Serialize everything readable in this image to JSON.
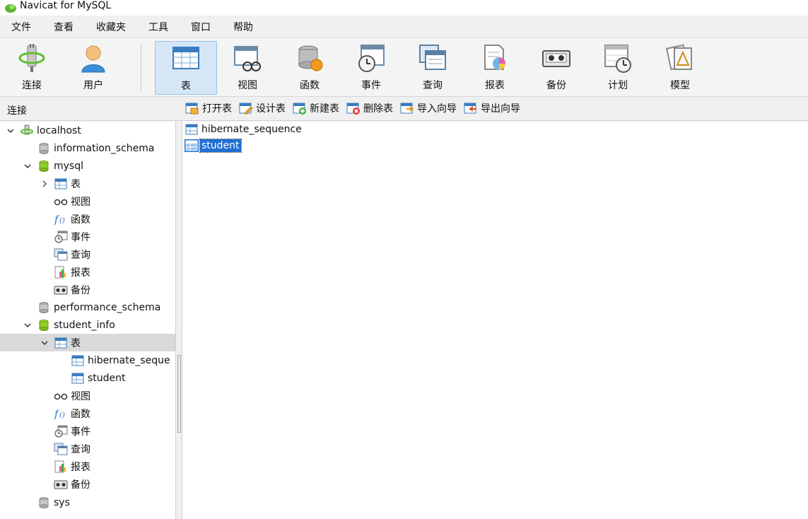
{
  "window": {
    "title": "Navicat for MySQL"
  },
  "menu": [
    "文件",
    "查看",
    "收藏夹",
    "工具",
    "窗口",
    "帮助"
  ],
  "toolbar": {
    "buttons": [
      {
        "label": "连接",
        "icon": "connect-icon"
      },
      {
        "label": "用户",
        "icon": "user-icon"
      },
      {
        "label": "表",
        "icon": "table-icon",
        "active": true
      },
      {
        "label": "视图",
        "icon": "view-icon"
      },
      {
        "label": "函数",
        "icon": "function-icon"
      },
      {
        "label": "事件",
        "icon": "event-icon"
      },
      {
        "label": "查询",
        "icon": "query-icon"
      },
      {
        "label": "报表",
        "icon": "report-icon"
      },
      {
        "label": "备份",
        "icon": "backup-icon"
      },
      {
        "label": "计划",
        "icon": "schedule-icon"
      },
      {
        "label": "模型",
        "icon": "model-icon"
      }
    ]
  },
  "subbar": {
    "connection_label": "连接",
    "actions": [
      "打开表",
      "设计表",
      "新建表",
      "删除表",
      "导入向导",
      "导出向导"
    ]
  },
  "tree": [
    {
      "label": "localhost",
      "icon": "connection-icon",
      "expanded": true
    },
    {
      "label": "information_schema",
      "icon": "database-icon"
    },
    {
      "label": "mysql",
      "icon": "database-open-icon",
      "expanded": true
    },
    {
      "label": "表",
      "icon": "tables-icon",
      "expanded": false
    },
    {
      "label": "视图",
      "icon": "views-icon"
    },
    {
      "label": "函数",
      "icon": "functions-icon"
    },
    {
      "label": "事件",
      "icon": "events-icon"
    },
    {
      "label": "查询",
      "icon": "queries-icon"
    },
    {
      "label": "报表",
      "icon": "reports-icon"
    },
    {
      "label": "备份",
      "icon": "backups-icon"
    },
    {
      "label": "performance_schema",
      "icon": "database-icon"
    },
    {
      "label": "student_info",
      "icon": "database-open-icon",
      "expanded": true
    },
    {
      "label": "表",
      "icon": "tables-icon",
      "expanded": true,
      "selected": true
    },
    {
      "label": "hibernate_seque",
      "icon": "table-icon"
    },
    {
      "label": "student",
      "icon": "table-icon"
    },
    {
      "label": "视图",
      "icon": "views-icon"
    },
    {
      "label": "函数",
      "icon": "functions-icon"
    },
    {
      "label": "事件",
      "icon": "events-icon"
    },
    {
      "label": "查询",
      "icon": "queries-icon"
    },
    {
      "label": "报表",
      "icon": "reports-icon"
    },
    {
      "label": "备份",
      "icon": "backups-icon"
    },
    {
      "label": "sys",
      "icon": "database-icon"
    }
  ],
  "objects": [
    {
      "label": "hibernate_sequence",
      "icon": "table-icon"
    },
    {
      "label": "student",
      "icon": "table-icon",
      "selected": true
    }
  ],
  "colors": {
    "selection": "#1e70d4",
    "toolbar_active": "#d5e6f6",
    "tree_selected": "#d9d9d9"
  }
}
